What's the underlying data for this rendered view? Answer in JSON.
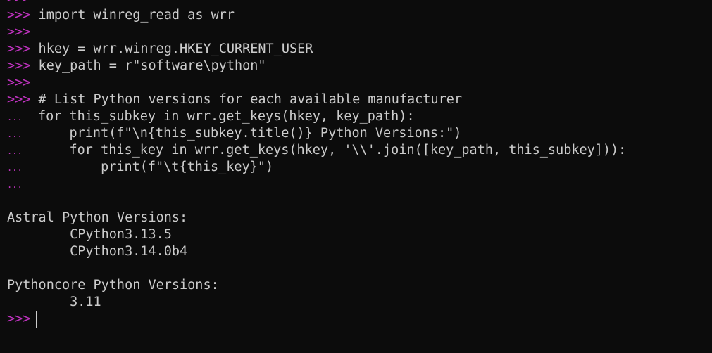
{
  "colors": {
    "background": "#0c0c0c",
    "text": "#cccccc",
    "prompt": "#c133c1"
  },
  "terminal": {
    "lines": [
      {
        "prompt": ">>>",
        "text": ""
      },
      {
        "prompt": ">>>",
        "text": " import winreg_read as wrr"
      },
      {
        "prompt": ">>>",
        "text": ""
      },
      {
        "prompt": ">>>",
        "text": " hkey = wrr.winreg.HKEY_CURRENT_USER"
      },
      {
        "prompt": ">>>",
        "text": " key_path = r\"software\\python\""
      },
      {
        "prompt": ">>>",
        "text": ""
      },
      {
        "prompt": ">>>",
        "text": " # List Python versions for each available manufacturer"
      },
      {
        "prompt": "...",
        "text": "  for this_subkey in wrr.get_keys(hkey, key_path):"
      },
      {
        "prompt": "...",
        "text": "      print(f\"\\n{this_subkey.title()} Python Versions:\")"
      },
      {
        "prompt": "...",
        "text": "      for this_key in wrr.get_keys(hkey, '\\\\'.join([key_path, this_subkey])):"
      },
      {
        "prompt": "...",
        "text": "          print(f\"\\t{this_key}\")"
      },
      {
        "prompt": "...",
        "text": ""
      },
      {
        "prompt": "",
        "text": ""
      },
      {
        "prompt": "",
        "text": "Astral Python Versions:"
      },
      {
        "prompt": "",
        "text": "        CPython3.13.5"
      },
      {
        "prompt": "",
        "text": "        CPython3.14.0b4"
      },
      {
        "prompt": "",
        "text": ""
      },
      {
        "prompt": "",
        "text": "Pythoncore Python Versions:"
      },
      {
        "prompt": "",
        "text": "        3.11"
      },
      {
        "prompt": ">>>",
        "text": "",
        "cursor": true
      }
    ]
  }
}
